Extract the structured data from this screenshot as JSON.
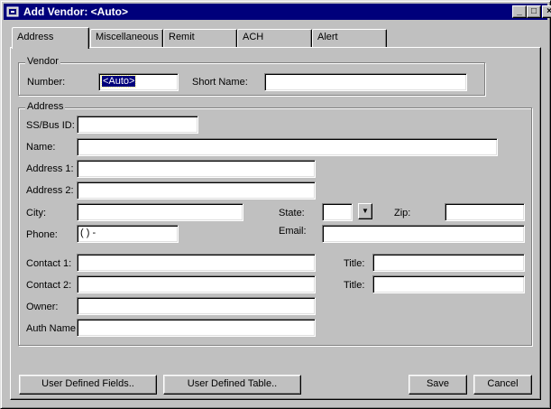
{
  "window": {
    "title": "Add Vendor: <Auto>",
    "minimize": "_",
    "maximize": "□",
    "close": "×"
  },
  "tabs": [
    {
      "label": "Address"
    },
    {
      "label": "Miscellaneous"
    },
    {
      "label": "Remit"
    },
    {
      "label": "ACH"
    },
    {
      "label": "Alert"
    }
  ],
  "vendor": {
    "legend": "Vendor",
    "number_label": "Number:",
    "number_value": "<Auto>",
    "short_name_label": "Short Name:",
    "short_name_value": ""
  },
  "address": {
    "legend": "Address",
    "ss_label": "SS/Bus ID:",
    "name_label": "Name:",
    "address1_label": "Address 1:",
    "address2_label": "Address 2:",
    "city_label": "City:",
    "state_label": "State:",
    "zip_label": "Zip:",
    "phone_label": "Phone:",
    "phone_value": "(   )   -",
    "email_label": "Email:",
    "contact1_label": "Contact 1:",
    "contact2_label": "Contact 2:",
    "title1_label": "Title:",
    "title2_label": "Title:",
    "owner_label": "Owner:",
    "auth_label": "Auth Name:"
  },
  "buttons": {
    "udf": "User Defined Fields..",
    "udt": "User Defined Table..",
    "save": "Save",
    "cancel": "Cancel"
  },
  "colors": {
    "titlebar": "#00007b",
    "face": "#c0c0c0"
  }
}
